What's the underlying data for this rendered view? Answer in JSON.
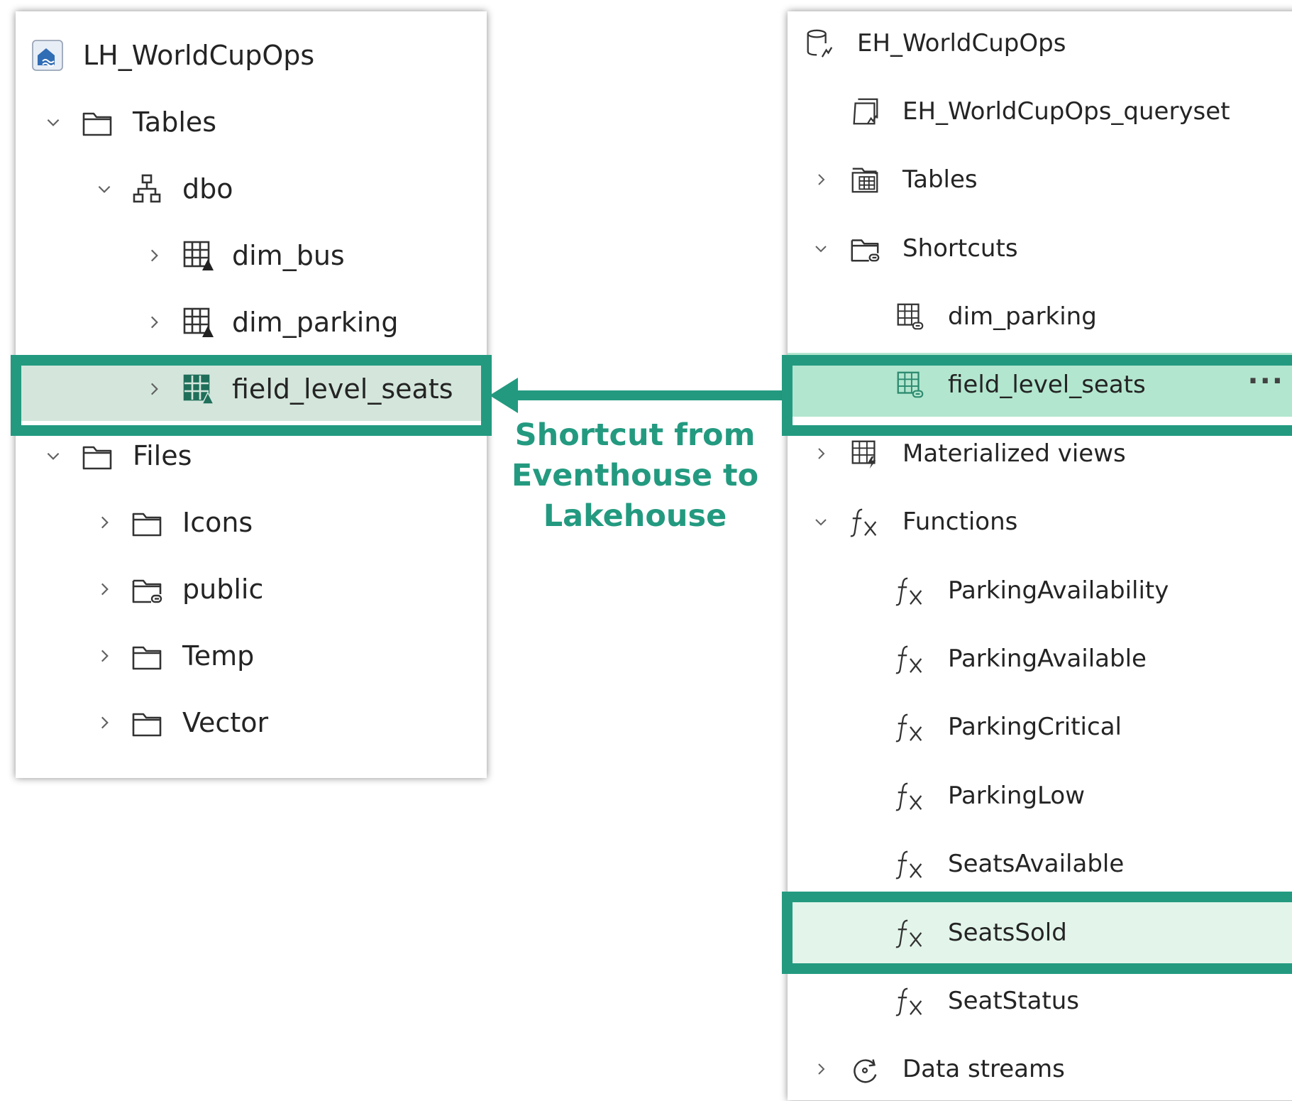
{
  "lakehouse": {
    "title": "LH_WorldCupOps",
    "items": [
      {
        "label": "Tables",
        "icon": "folder-icon",
        "expanded": true
      },
      {
        "label": "dbo",
        "icon": "schema-icon",
        "expanded": true
      },
      {
        "label": "dim_bus",
        "icon": "delta-table-icon",
        "expanded": false
      },
      {
        "label": "dim_parking",
        "icon": "delta-table-icon",
        "expanded": false
      },
      {
        "label": "field_level_seats",
        "icon": "delta-table-shortcut-icon",
        "expanded": false,
        "selected": true
      },
      {
        "label": "Files",
        "icon": "folder-icon",
        "expanded": true
      },
      {
        "label": "Icons",
        "icon": "folder-icon",
        "expanded": false
      },
      {
        "label": "public",
        "icon": "folder-shortcut-icon",
        "expanded": false
      },
      {
        "label": "Temp",
        "icon": "folder-icon",
        "expanded": false
      },
      {
        "label": "Vector",
        "icon": "folder-icon",
        "expanded": false
      }
    ]
  },
  "eventhouse": {
    "title": "EH_WorldCupOps",
    "items": [
      {
        "label": "EH_WorldCupOps_queryset",
        "icon": "queryset-icon"
      },
      {
        "label": "Tables",
        "icon": "tables-icon",
        "expanded": false
      },
      {
        "label": "Shortcuts",
        "icon": "shortcut-folder-icon",
        "expanded": true
      },
      {
        "label": "dim_parking",
        "icon": "table-shortcut-icon"
      },
      {
        "label": "field_level_seats",
        "icon": "table-shortcut-icon",
        "selected": true,
        "more": "···"
      },
      {
        "label": "Materialized views",
        "icon": "materialized-view-icon",
        "expanded": false
      },
      {
        "label": "Functions",
        "icon": "function-icon",
        "expanded": true
      },
      {
        "label": "ParkingAvailability",
        "icon": "function-icon"
      },
      {
        "label": "ParkingAvailable",
        "icon": "function-icon"
      },
      {
        "label": "ParkingCritical",
        "icon": "function-icon"
      },
      {
        "label": "ParkingLow",
        "icon": "function-icon"
      },
      {
        "label": "SeatsAvailable",
        "icon": "function-icon"
      },
      {
        "label": "SeatsSold",
        "icon": "function-icon",
        "highlighted": true
      },
      {
        "label": "SeatStatus",
        "icon": "function-icon"
      },
      {
        "label": "Data streams",
        "icon": "data-stream-icon",
        "expanded": false
      }
    ]
  },
  "annotation": {
    "line1": "Shortcut from",
    "line2": "Eventhouse to",
    "line3": "Lakehouse"
  },
  "colors": {
    "accent": "#239a80",
    "left_selected_bg": "#d4e6dc",
    "right_selected_bg": "#b3e6cf",
    "right_highlight_bg": "#e3f5eb"
  }
}
